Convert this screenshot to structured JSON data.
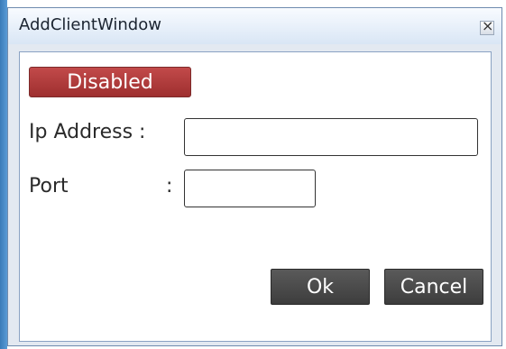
{
  "window": {
    "title": "AddClientWindow"
  },
  "buttons": {
    "disabled_label": "Disabled",
    "ok_label": "Ok",
    "cancel_label": "Cancel"
  },
  "form": {
    "ip_label": "Ip Address :",
    "port_label": "Port",
    "port_colon": ":",
    "ip_value": "",
    "port_value": ""
  },
  "icons": {
    "close": "close-icon"
  },
  "colors": {
    "disabled_button": "#b23b3b",
    "action_button": "#4a4a4a",
    "title_text": "#1b2430"
  }
}
